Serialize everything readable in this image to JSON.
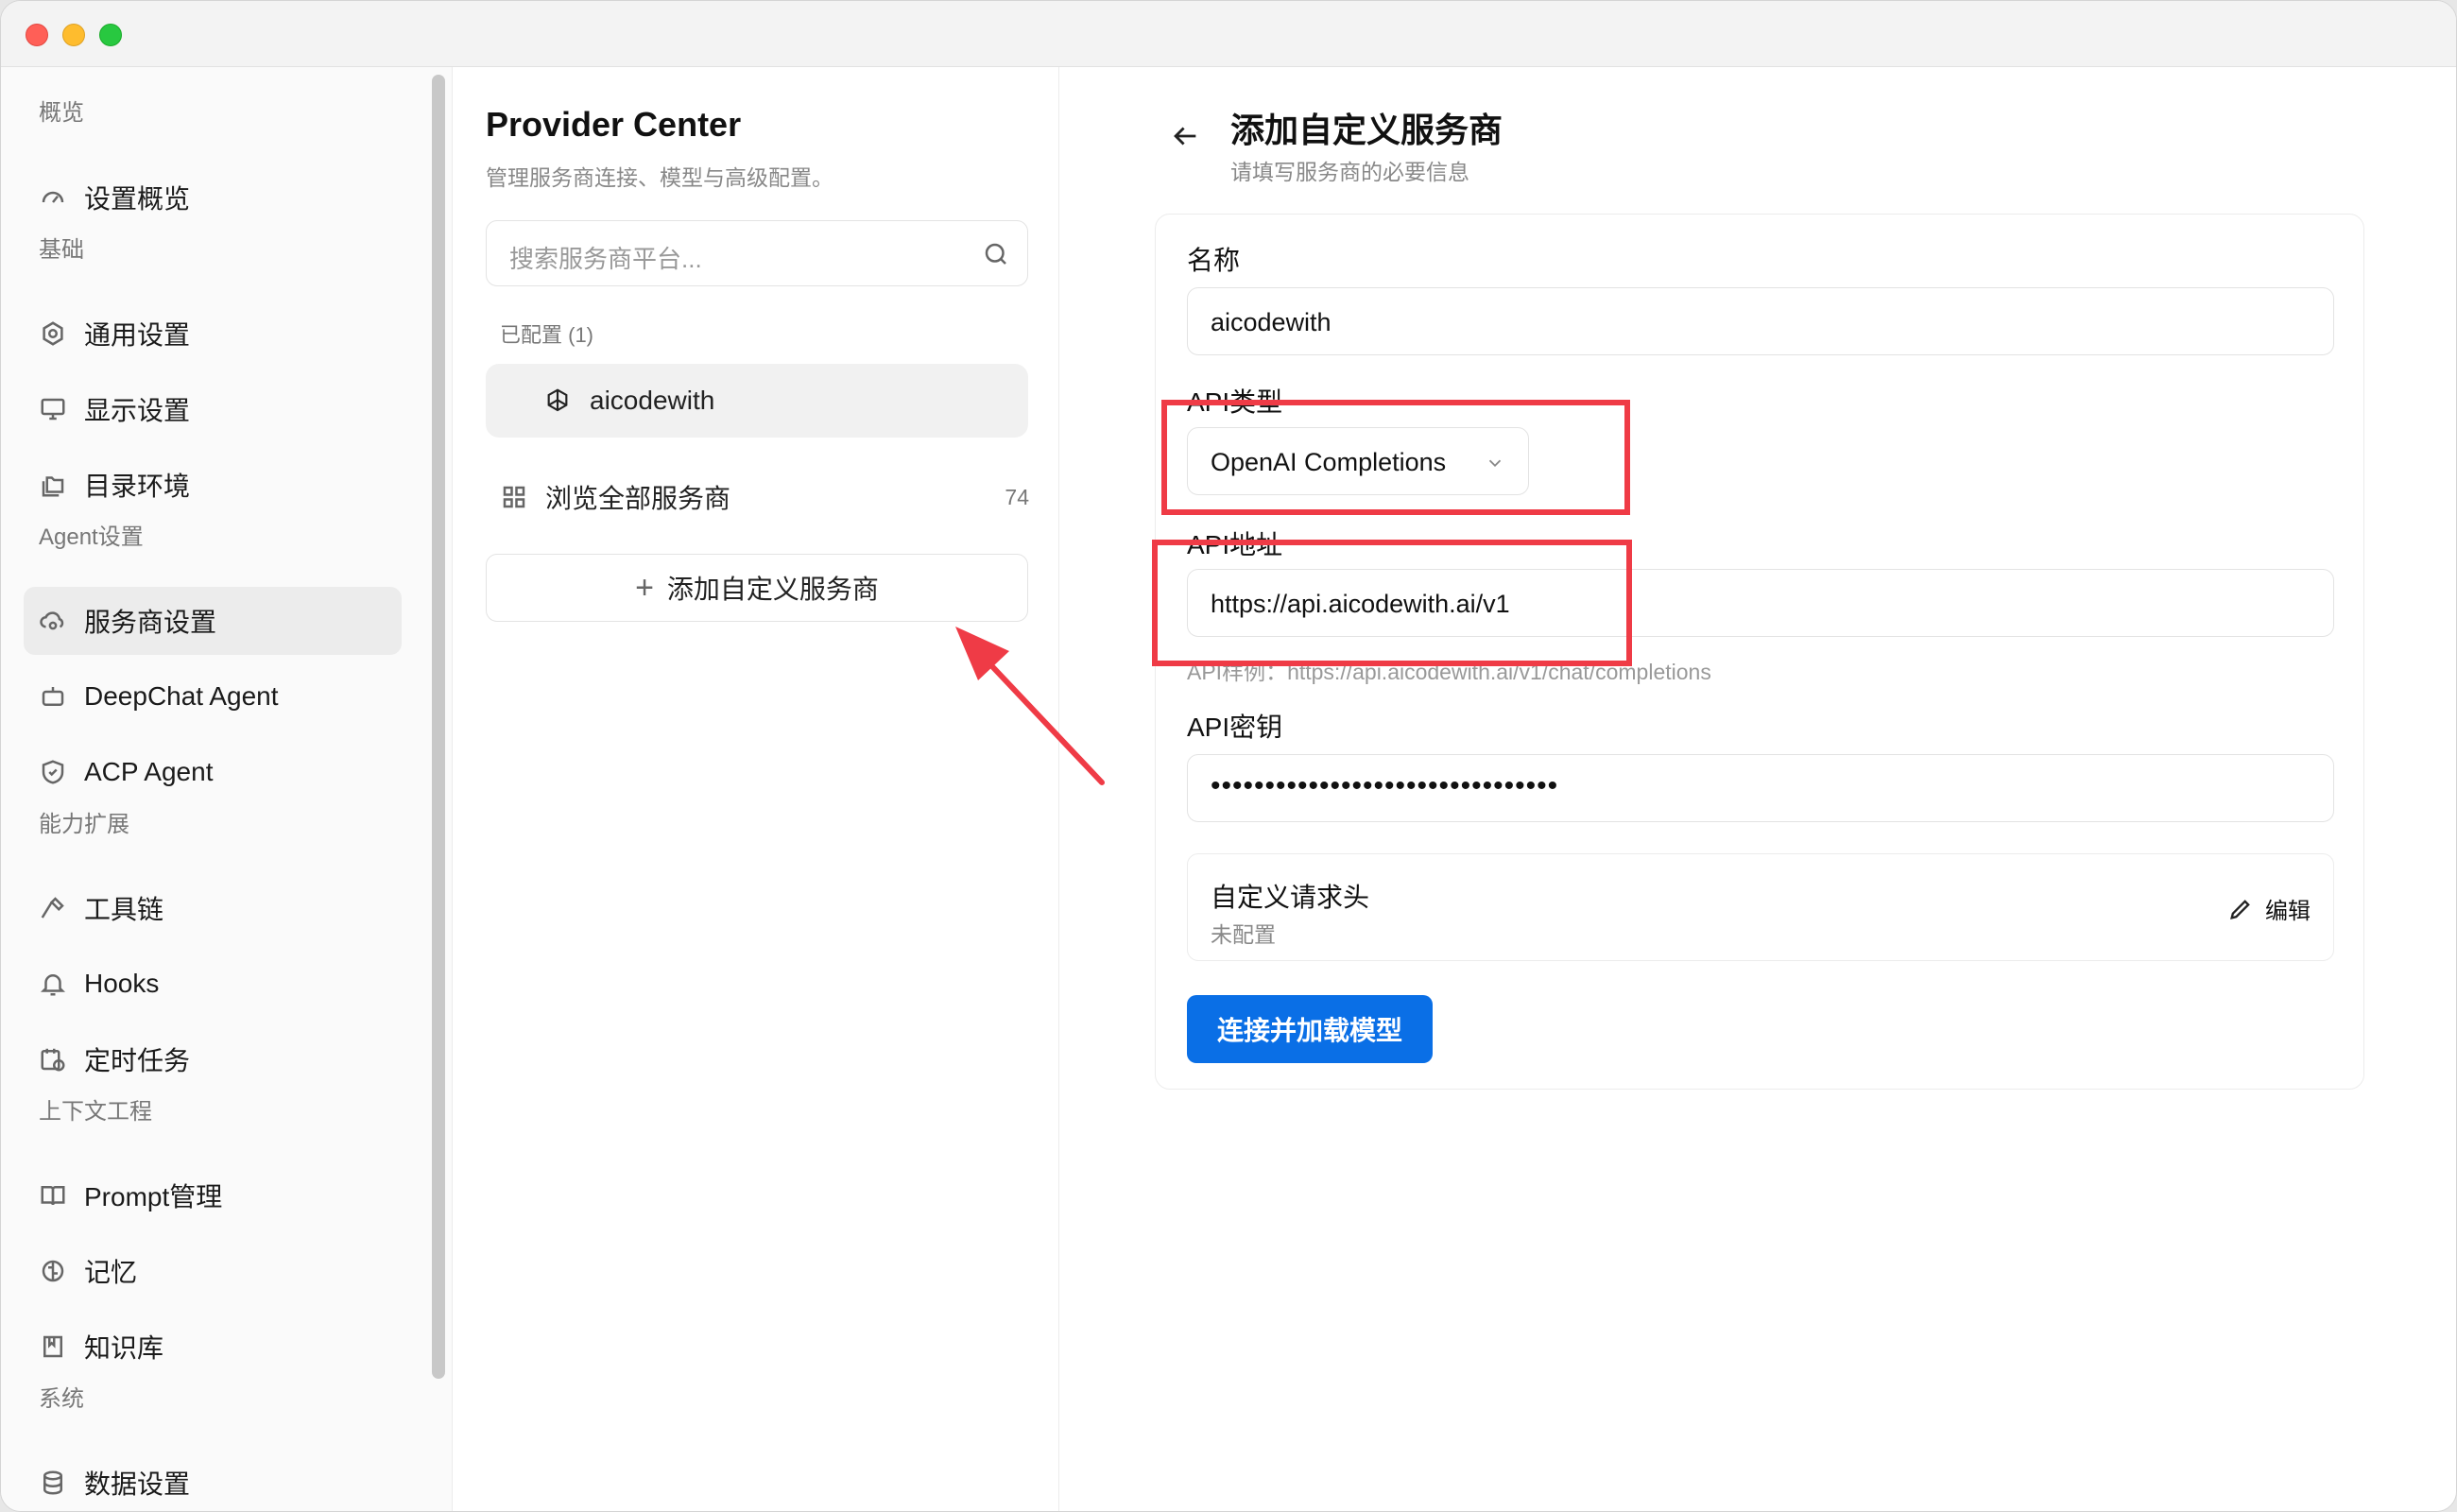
{
  "sidebar": {
    "sections": [
      "概览",
      "基础",
      "Agent设置",
      "能力扩展",
      "上下文工程",
      "系统"
    ],
    "items": [
      {
        "label": "设置概览",
        "icon": "gauge-icon"
      },
      {
        "label": "通用设置",
        "icon": "settings-gear-icon"
      },
      {
        "label": "显示设置",
        "icon": "monitor-icon"
      },
      {
        "label": "目录环境",
        "icon": "folders-icon"
      },
      {
        "label": "服务商设置",
        "icon": "cloud-cog-icon"
      },
      {
        "label": "DeepChat Agent",
        "icon": "bot-icon"
      },
      {
        "label": "ACP Agent",
        "icon": "shield-check-icon"
      },
      {
        "label": "工具链",
        "icon": "hammer-icon"
      },
      {
        "label": "Hooks",
        "icon": "bell-icon"
      },
      {
        "label": "定时任务",
        "icon": "calendar-clock-icon"
      },
      {
        "label": "Prompt管理",
        "icon": "book-open-icon"
      },
      {
        "label": "记忆",
        "icon": "brain-icon"
      },
      {
        "label": "知识库",
        "icon": "bookmark-book-icon"
      },
      {
        "label": "数据设置",
        "icon": "database-icon"
      }
    ]
  },
  "providers": {
    "title": "Provider Center",
    "subtitle": "管理服务商连接、模型与高级配置。",
    "search_placeholder": "搜索服务商平台...",
    "configured_label": "已配置 (1)",
    "configured_item": "aicodewith",
    "browse_label": "浏览全部服务商",
    "browse_count": "74",
    "add_label": "添加自定义服务商"
  },
  "form": {
    "title": "添加自定义服务商",
    "subtitle": "请填写服务商的必要信息",
    "name_label": "名称",
    "name_value": "aicodewith",
    "api_type_label": "API类型",
    "api_type_value": "OpenAI Completions",
    "api_url_label": "API地址",
    "api_url_value": "https://api.aicodewith.ai/v1",
    "api_url_hint": "API样例：https://api.aicodewith.ai/v1/chat/completions",
    "api_key_label": "API密钥",
    "api_key_value": "••••••••••••••••••••••••••••••••",
    "headers_title": "自定义请求头",
    "headers_status": "未配置",
    "headers_edit": "编辑",
    "connect_label": "连接并加载模型"
  },
  "colors": {
    "accent": "#0a6fe6",
    "annotation": "#ef3b46"
  }
}
